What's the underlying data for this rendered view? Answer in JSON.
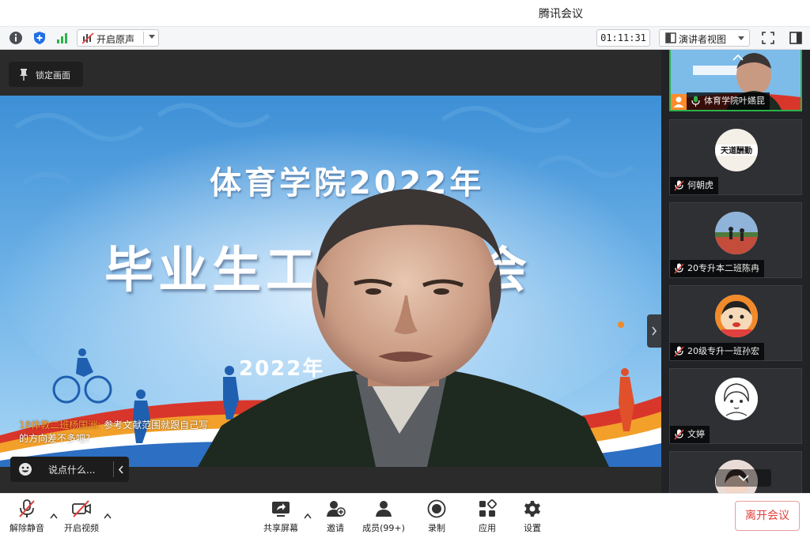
{
  "window": {
    "title": "腾讯会议"
  },
  "toolbar": {
    "original_sound_label": "开启原声",
    "timer": "01:11:31",
    "view_label": "演讲者视图"
  },
  "stage": {
    "lock_label": "锁定画面",
    "slide": {
      "line1": "体育学院2022年",
      "line2": "毕业生工",
      "line2_tail": "会",
      "date": "2022年"
    },
    "chat": {
      "sender": "18体教二班杨国洲:",
      "message": "参考文献范围就跟自己写的方向差不多吧?",
      "input_placeholder": "说点什么..."
    }
  },
  "participants": [
    {
      "name": "体育学院叶嬿昆",
      "role": "host"
    },
    {
      "name": "何朝虎",
      "avatar_text": "天道酬勤"
    },
    {
      "name": "20专升本二班陈冉"
    },
    {
      "name": "20级专升一班孙宏"
    },
    {
      "name": "文婷"
    },
    {
      "name": ""
    }
  ],
  "controls": {
    "unmute": "解除静音",
    "start_video": "开启视频",
    "share_screen": "共享屏幕",
    "invite": "邀请",
    "members": "成员(99+)",
    "record": "录制",
    "apps": "应用",
    "settings": "设置",
    "leave": "离开会议"
  },
  "colors": {
    "accent_blue": "#1f6fe5",
    "leave_red": "#e0413e",
    "signal_green": "#2bb24c"
  }
}
